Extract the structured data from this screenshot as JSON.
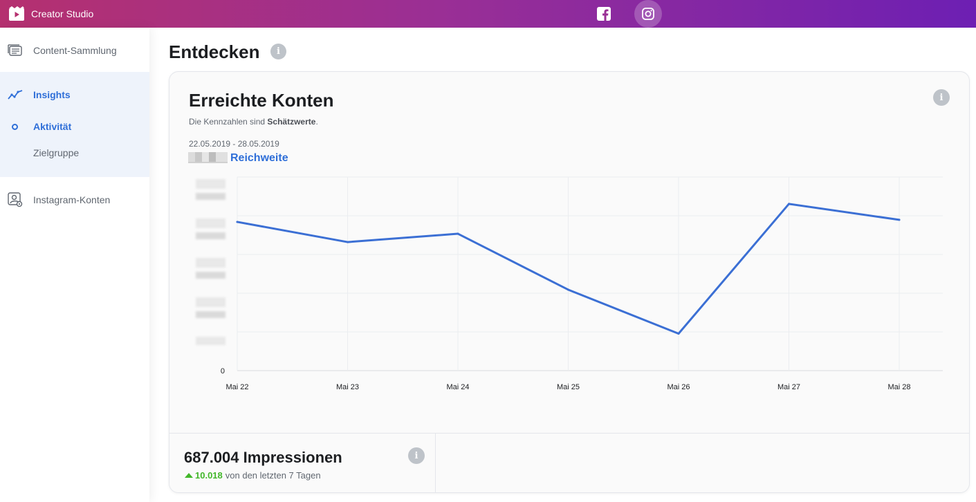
{
  "topbar": {
    "app_name": "Creator Studio",
    "platforms": [
      {
        "name": "Facebook",
        "icon": "facebook-icon"
      },
      {
        "name": "Instagram",
        "icon": "instagram-icon",
        "active": true
      }
    ]
  },
  "sidebar": {
    "items": [
      {
        "label": "Content-Sammlung",
        "icon": "content-library-icon"
      },
      {
        "label": "Insights",
        "icon": "insights-chart-icon",
        "active": true
      },
      {
        "label": "Aktivität",
        "icon": "dot-icon",
        "active": true
      },
      {
        "label": "Zielgruppe"
      },
      {
        "label": "Instagram-Konten",
        "icon": "account-settings-icon"
      }
    ]
  },
  "main": {
    "title": "Entdecken",
    "card": {
      "title": "Erreichte Konten",
      "subtitle_prefix": "Die Kennzahlen sind ",
      "subtitle_bold": "Schätzwerte",
      "subtitle_suffix": ".",
      "date_range": "22.05.2019 - 28.05.2019",
      "legend_label": "Reichweite"
    },
    "metric": {
      "value": "687.004 Impressionen",
      "delta": "10.018",
      "delta_text": "von den letzten 7 Tagen"
    }
  },
  "colors": {
    "accent": "#2f6fd8",
    "line": "#3b6fd4",
    "positive": "#42b72a",
    "topbar_start": "#b5306f",
    "topbar_end": "#6d1fb3"
  },
  "chart_data": {
    "type": "line",
    "categories": [
      "Mai 22",
      "Mai 23",
      "Mai 24",
      "Mai 25",
      "Mai 26",
      "Mai 27",
      "Mai 28"
    ],
    "series": [
      {
        "name": "Reichweite",
        "values": [
          0.768,
          0.664,
          0.707,
          0.418,
          0.191,
          0.861,
          0.779
        ]
      }
    ],
    "y_tick_labels": [
      "0"
    ],
    "y_note": "values shown relative to top of plot area (max = 1.0); absolute y tick labels are blurred in the original",
    "ylim": [
      0,
      1
    ],
    "grid": true
  }
}
